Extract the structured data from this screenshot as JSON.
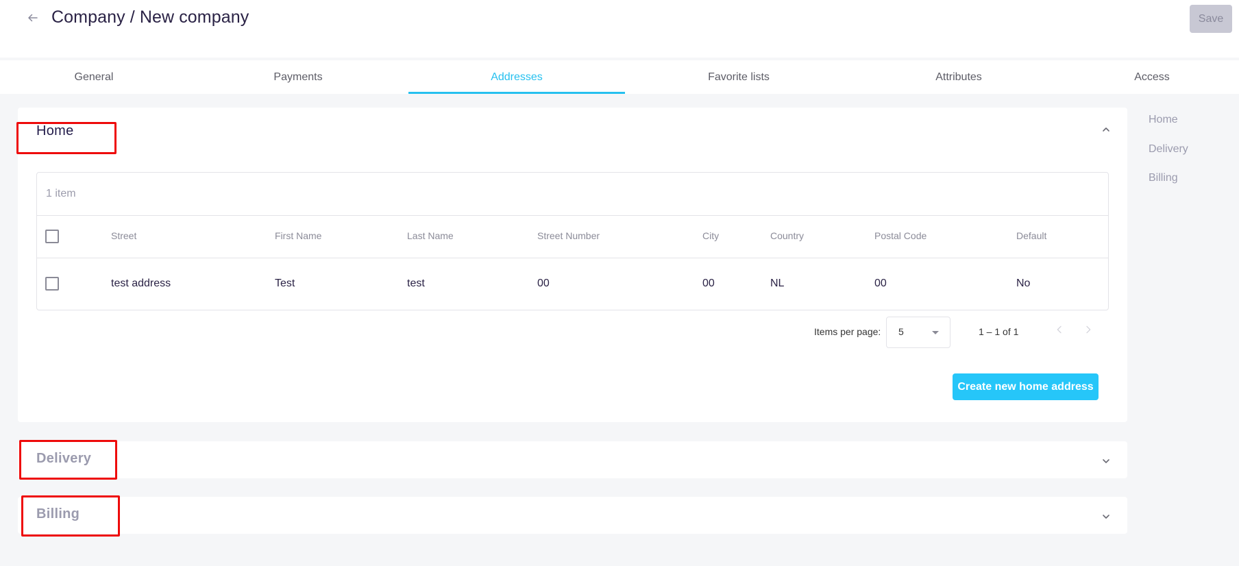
{
  "header": {
    "title": "Company / New company",
    "save_label": "Save",
    "back_icon": "arrow-left-icon"
  },
  "tabs": [
    {
      "label": "General",
      "active": false
    },
    {
      "label": "Payments",
      "active": false
    },
    {
      "label": "Addresses",
      "active": true
    },
    {
      "label": "Favorite lists",
      "active": false
    },
    {
      "label": "Attributes",
      "active": false
    },
    {
      "label": "Access",
      "active": false
    }
  ],
  "sections": {
    "home": {
      "title": "Home",
      "expanded": true,
      "item_count": "1 item",
      "columns": [
        "Street",
        "First Name",
        "Last Name",
        "Street Number",
        "City",
        "Country",
        "Postal Code",
        "Default"
      ],
      "rows": [
        [
          "test address",
          "Test",
          "test",
          "00",
          "00",
          "NL",
          "00",
          "No"
        ]
      ],
      "paginator": {
        "items_per_page_label": "Items per page:",
        "items_per_page_value": "5",
        "range": "1 – 1 of 1"
      },
      "create_label": "Create new home address"
    },
    "delivery": {
      "title": "Delivery",
      "expanded": false
    },
    "billing": {
      "title": "Billing",
      "expanded": false
    }
  },
  "side_nav": [
    "Home",
    "Delivery",
    "Billing"
  ],
  "colors": {
    "accent": "#26c0ef",
    "button_primary": "#26c6f9",
    "save_disabled": "#c8c8d4",
    "title": "#2a2245",
    "annotation_red": "#ee0a0a"
  }
}
